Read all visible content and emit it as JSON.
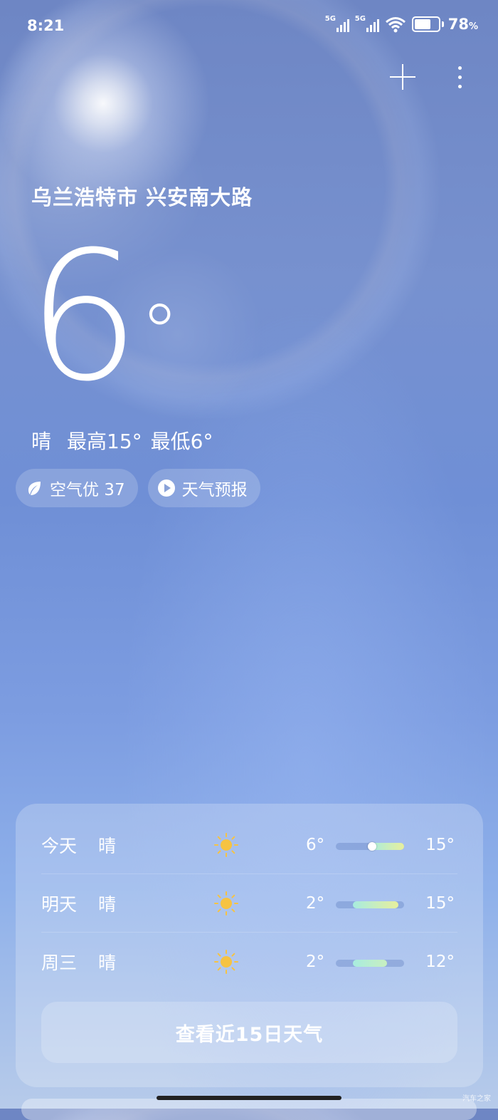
{
  "status_bar": {
    "time": "8:21",
    "network_1": "5G",
    "network_2": "5G",
    "battery_level": 78,
    "battery_text": "78",
    "battery_unit": "%"
  },
  "header": {
    "add_icon": "plus-icon",
    "menu_icon": "more-vertical-icon"
  },
  "current": {
    "location": "乌兰浩特市 兴安南大路",
    "temperature": "6",
    "degree_symbol": "°",
    "condition": "晴",
    "high": "最高15°",
    "low": "最低6°"
  },
  "chips": {
    "air_quality": "空气优 37",
    "forecast_video": "天气预报"
  },
  "daily_forecast": [
    {
      "day": "今天",
      "condition": "晴",
      "icon": "sun-icon",
      "low": "6°",
      "high": "15°",
      "current_marker": true
    },
    {
      "day": "明天",
      "condition": "晴",
      "icon": "sun-icon",
      "low": "2°",
      "high": "15°",
      "current_marker": false
    },
    {
      "day": "周三",
      "condition": "晴",
      "icon": "sun-icon",
      "low": "2°",
      "high": "12°",
      "current_marker": false
    }
  ],
  "forecast_button": "查看近15日天气",
  "watermark": "汽车之家",
  "colors": {
    "sky_top": "#6e86c4",
    "sky_bottom": "#b7cbea",
    "sun_icon": "#f6c342",
    "range_start": "#a8ecdf",
    "range_end": "#e7ef9d"
  }
}
